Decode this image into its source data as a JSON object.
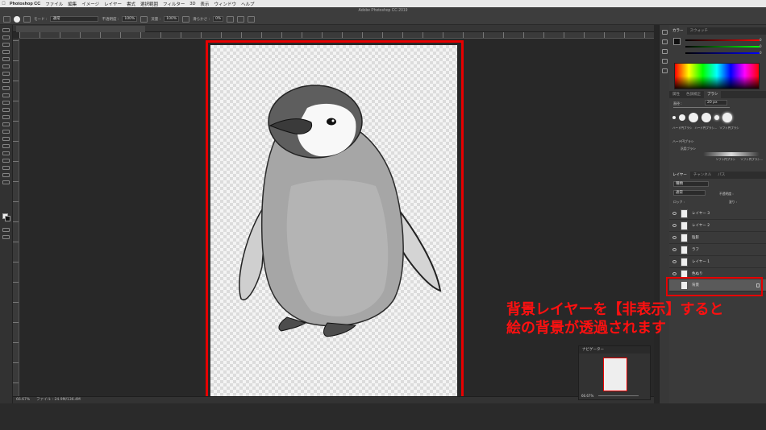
{
  "menubar": {
    "app_name": "Photoshop CC",
    "items": [
      "ファイル",
      "編集",
      "イメージ",
      "レイヤー",
      "書式",
      "選択範囲",
      "フィルター",
      "3D",
      "表示",
      "ウィンドウ",
      "ヘルプ"
    ]
  },
  "window_title": "Adobe Photoshop CC 2019",
  "options": {
    "mode_label": "モード :",
    "mode_value": "通常",
    "opacity_label": "不透明度 :",
    "opacity_value": "100%",
    "flow_label": "流量 :",
    "flow_value": "100%",
    "smoothing_label": "滑らかさ :",
    "smoothing_value": "0%"
  },
  "document": {
    "zoom": "66.67%",
    "file_info": "ファイル : 24.9M/136.4M"
  },
  "navigator": {
    "title": "ナビゲーター",
    "zoom": "66.67%"
  },
  "panels": {
    "color_tabs": [
      "カラー",
      "スウォッチ"
    ],
    "color_values": {
      "r": "0",
      "g": "0",
      "b": "0"
    },
    "brush_tabs": [
      "属性",
      "色調補正",
      "ブラシ"
    ],
    "brush_size_label": "直径 :",
    "brush_size_value": "20 px",
    "brush_names": [
      "ハード円ブラシ",
      "ハード円ブラシ...",
      "ソフト円ブラシ"
    ],
    "brush_group_1": "ハード円ブラシ",
    "brush_group_2": "汎用ブラシ",
    "brush_names_2": [
      "ソフト円ブラシ",
      "ソフト円ブラシ..."
    ],
    "layer_tabs": [
      "レイヤー",
      "チャンネル",
      "パス"
    ],
    "layer_filter": "種類",
    "layer_mode": "通常",
    "layer_opacity_label": "不透明度 :",
    "layer_lock_label": "ロック :",
    "layer_fill_label": "塗り :"
  },
  "layers": [
    {
      "name": "レイヤー 3"
    },
    {
      "name": "レイヤー 2"
    },
    {
      "name": "陰影"
    },
    {
      "name": "ラフ"
    },
    {
      "name": "レイヤー 1"
    },
    {
      "name": "色ぬり"
    },
    {
      "name": "背景",
      "selected": true
    }
  ],
  "annotation": {
    "line1": "背景レイヤーを【非表示】すると",
    "line2": "絵の背景が透過されます"
  },
  "colors": {
    "highlight": "#e60000",
    "annotation_text": "#ff1010"
  }
}
